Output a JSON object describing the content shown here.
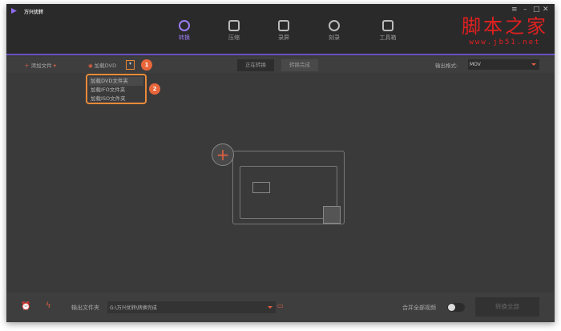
{
  "app": {
    "title": "万兴优转"
  },
  "nav": [
    {
      "label": "转换",
      "active": true,
      "icon": "convert-icon"
    },
    {
      "label": "压缩",
      "icon": "compress-icon"
    },
    {
      "label": "录屏",
      "icon": "record-icon"
    },
    {
      "label": "刻录",
      "icon": "burn-icon"
    },
    {
      "label": "工具箱",
      "icon": "toolbox-icon"
    }
  ],
  "watermark": {
    "line1": "脚本之家",
    "line2": "www.jb51.net"
  },
  "toolbar": {
    "add_file": "添加文件",
    "load_dvd": "加载DVD",
    "tab_converting": "正在转换",
    "tab_done": "转换完成",
    "output_format_label": "输出格式:",
    "output_format": "MOV"
  },
  "menu": [
    "加载DVD文件夹",
    "加载IFO文件夹",
    "加载ISO文件夹"
  ],
  "badges": [
    "1",
    "2"
  ],
  "bottom": {
    "output_folder_label": "输出文件夹",
    "output_path": "G:\\万兴优转\\转换完成",
    "merge_label": "合并全部视频",
    "convert_all": "转换全部"
  },
  "colors": {
    "accent": "#9b7df5",
    "highlight": "#e8663a"
  }
}
